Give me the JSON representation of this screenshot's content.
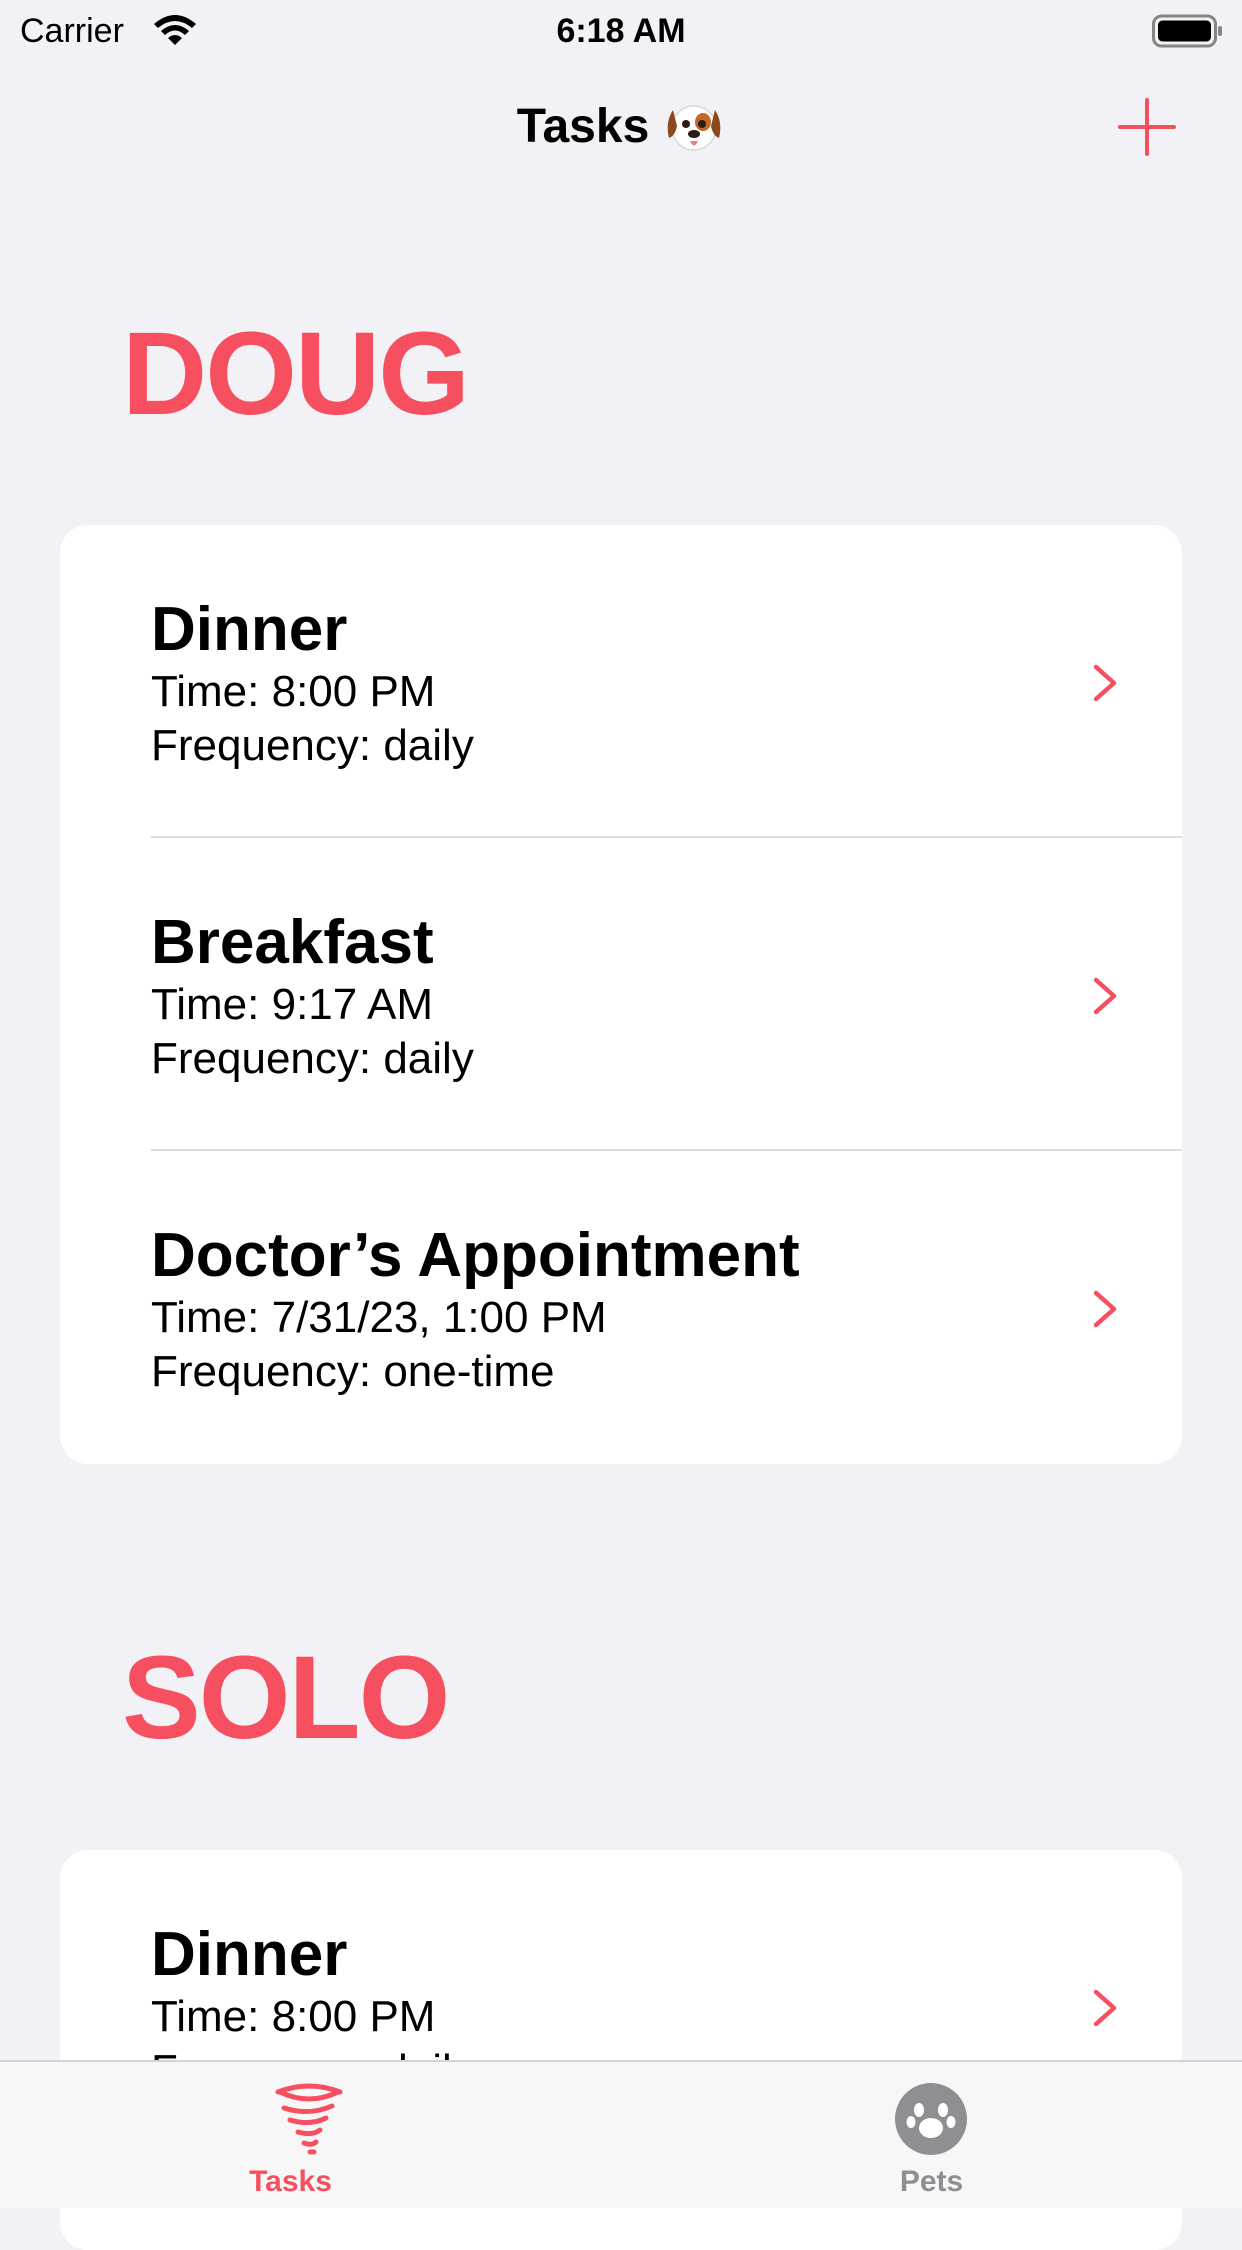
{
  "status_bar": {
    "carrier": "Carrier",
    "time": "6:18 AM",
    "icons": [
      "wifi-icon",
      "battery-icon"
    ]
  },
  "nav": {
    "title": "Tasks",
    "emoji_icon": "dog-face-icon",
    "add_icon": "plus-icon"
  },
  "colors": {
    "accent": "#F64F5F",
    "background": "#F2F1F6",
    "card": "#FFFFFF",
    "inactive_tab": "#8E8E93"
  },
  "sections": [
    {
      "title": "DOUG",
      "tasks": [
        {
          "title": "Dinner",
          "time": "Time: 8:00 PM",
          "frequency": "Frequency: daily"
        },
        {
          "title": "Breakfast",
          "time": "Time: 9:17 AM",
          "frequency": "Frequency: daily"
        },
        {
          "title": "Doctor’s Appointment",
          "time": "Time: 7/31/23, 1:00 PM",
          "frequency": "Frequency: one-time"
        }
      ]
    },
    {
      "title": "SOLO",
      "tasks": [
        {
          "title": "Dinner",
          "time": "Time: 8:00 PM",
          "frequency": "Frequency: daily"
        }
      ]
    }
  ],
  "tab_bar": {
    "tabs": [
      {
        "label": "Tasks",
        "icon": "tornado-icon",
        "selected": true
      },
      {
        "label": "Pets",
        "icon": "paw-icon",
        "selected": false
      }
    ]
  }
}
